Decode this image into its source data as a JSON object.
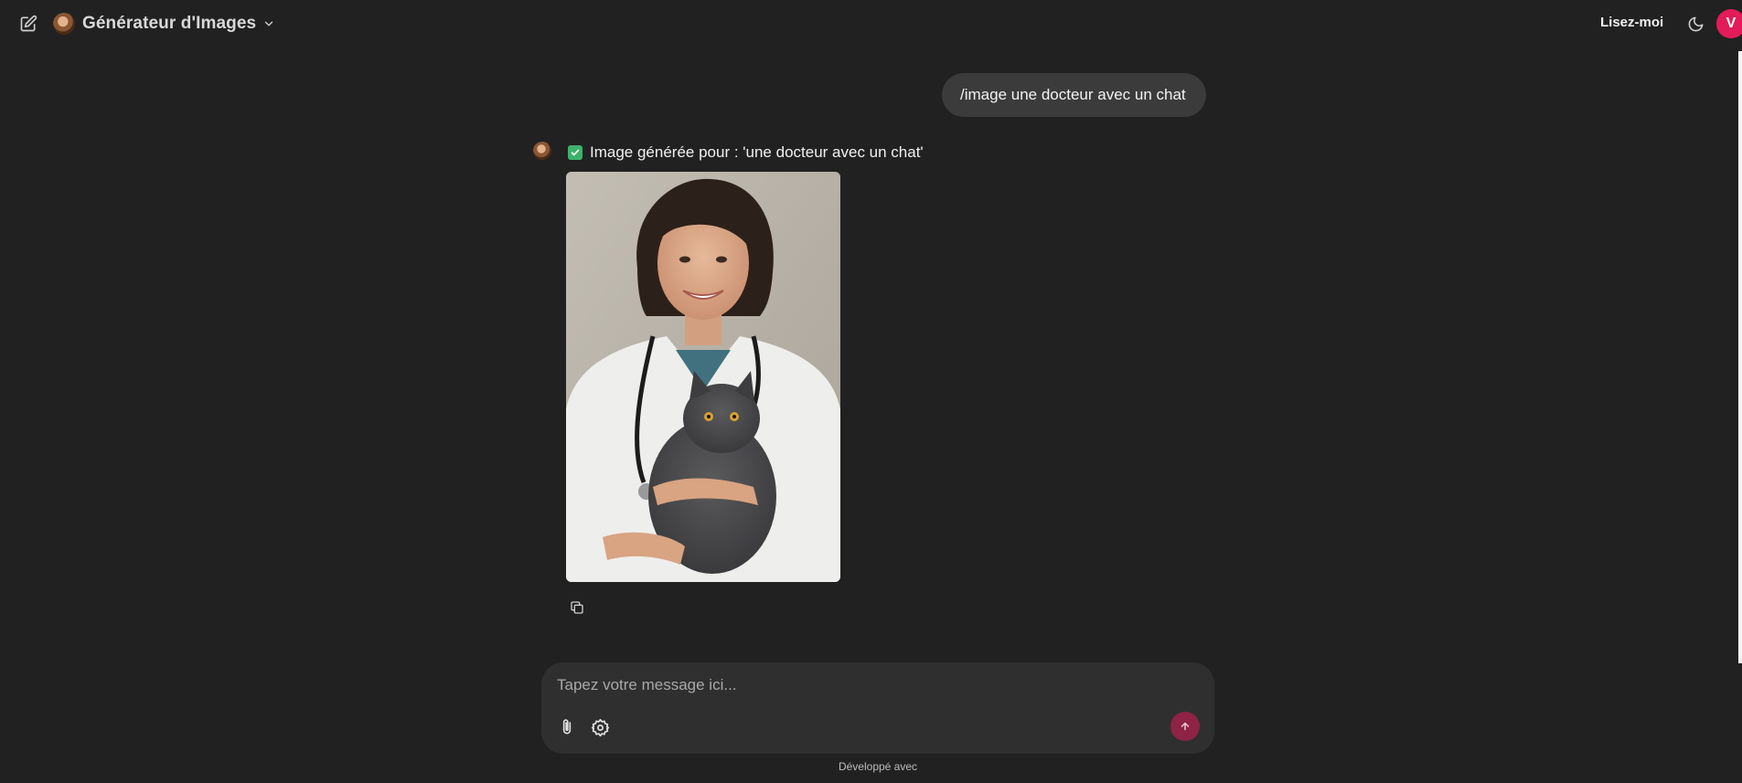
{
  "header": {
    "model_name": "Générateur d'Images",
    "readme_label": "Lisez-moi",
    "user_initial": "V",
    "icons": {
      "new_chat": "edit-pencil-icon",
      "model_chevron": "chevron-down-icon",
      "theme_toggle": "moon-icon"
    },
    "avatar_color": "#e31b5a"
  },
  "chat": {
    "user_message": "/image une docteur avec un chat",
    "assistant_message": "Image générée pour : 'une docteur avec un chat'",
    "assistant_status_icon": "check-mark-button-icon",
    "generated_image": {
      "subject": "une docteur avec un chat"
    },
    "copy_icon": "copy-icon"
  },
  "composer": {
    "placeholder": "Tapez votre message ici...",
    "value": "",
    "attach_icon": "paperclip-icon",
    "settings_icon": "gear-icon",
    "send_icon": "arrow-up-icon",
    "send_color": "#8e2346"
  },
  "footer": {
    "text": "Développé avec"
  },
  "colors": {
    "background": "#212121",
    "composer_background": "#2f2f2f",
    "user_bubble": "#3b3b3b"
  }
}
